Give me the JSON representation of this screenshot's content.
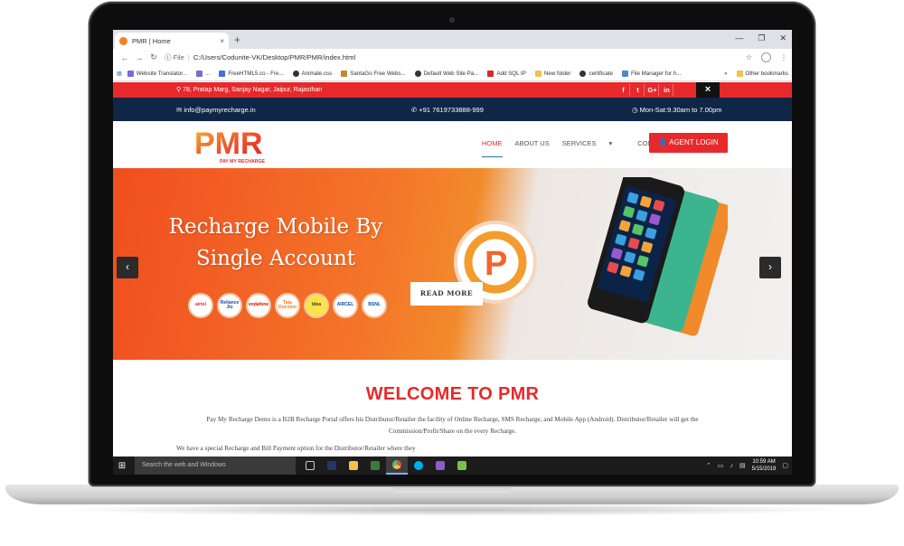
{
  "browser": {
    "tab_title": "PMR | Home",
    "tab_close": "×",
    "new_tab": "+",
    "window_controls": [
      "—",
      "❐",
      "✕"
    ],
    "url_scheme": "File",
    "url": "C:/Users/Codunite-VK/Desktop/PMR/PMR/index.html",
    "bookmarks": [
      {
        "label": "Website Translator...",
        "color": "#7a6cd6"
      },
      {
        "label": "...",
        "color": "#7a6cd6"
      },
      {
        "label": "FreeHTML5.co - Fre...",
        "color": "#4b6fd1"
      },
      {
        "label": "Animate.css",
        "color": "#333333"
      },
      {
        "label": "SantaGo Free Webs...",
        "color": "#c08a2b"
      },
      {
        "label": "Default Web Site Pa...",
        "color": "#333333"
      },
      {
        "label": "Add SQL IP",
        "color": "#d42b2b"
      },
      {
        "label": "New folder",
        "color": "#f2c24b"
      },
      {
        "label": "certificate",
        "color": "#333333"
      },
      {
        "label": "File Manager for h...",
        "color": "#4b8cd1"
      }
    ],
    "bookmarks_more": "»",
    "other_bookmarks": "Other bookmarks"
  },
  "site": {
    "address": "78, Pratap Marg, Sanjay Nagar, Jaipur, Rajasthan",
    "social": [
      "f",
      "t",
      "G+",
      "in"
    ],
    "close_label": "×",
    "email": "info@paymyrecharge.in",
    "phone": "+91 7619733888-999",
    "hours": "Mon-Sat:9.30am to 7.00pm",
    "logo_text": "PMR",
    "logo_tagline": "PAY MY RECHARGE",
    "nav": [
      "HOME",
      "ABOUT US",
      "SERVICES",
      "CONTACT"
    ],
    "services_caret": "▾",
    "agent_login": "AGENT LOGIN",
    "hero_line1": "Recharge Mobile By",
    "hero_line2": "Single Account",
    "operators": [
      "airtel",
      "Reliance Jio",
      "vodafone",
      "Tata Docomo",
      "Idea",
      "AIRCEL",
      "BSNL"
    ],
    "read_more": "READ MORE",
    "prev": "‹",
    "next": "›",
    "welcome_title": "WELCOME TO PMR",
    "welcome_text": "Pay My Recharge Demo is a B2B Recharge Portal offers his Distributor/Retailer the facility of Online Recharge, SMS Recharge, and Mobile App (Android). Distributor/Retailer will get the Commission/Profit/Share on the every Recharge.",
    "welcome_text2": "We have a special Recharge and Bill Payment option for the Distributor/Retailer where they"
  },
  "taskbar": {
    "search_placeholder": "Search the web and Windows",
    "time": "10:59 AM",
    "date": "5/15/2019"
  },
  "colors": {
    "brand_red": "#e8292b",
    "navy": "#102646",
    "orange": "#f4762a"
  }
}
